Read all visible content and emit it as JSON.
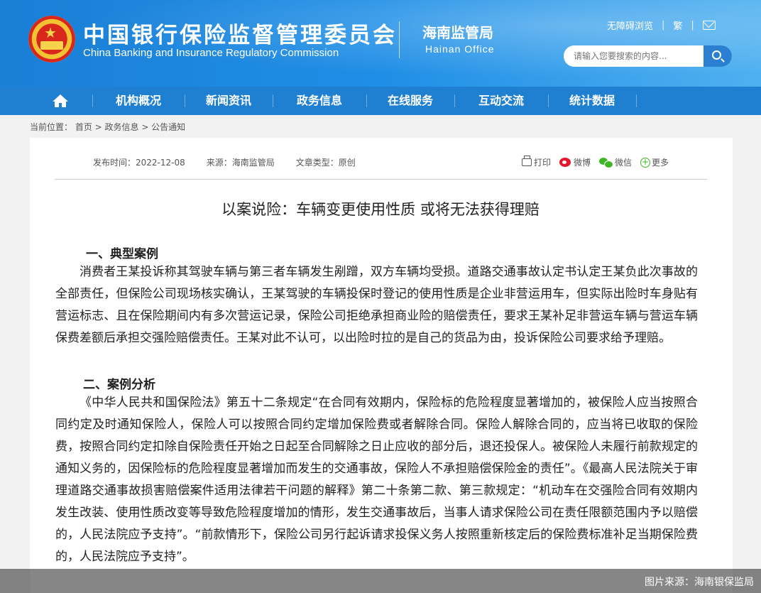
{
  "header": {
    "org_cn": "中国银行保险监督管理委员会",
    "org_en": "China Banking and Insurance Regulatory Commission",
    "office_cn": "海南监管局",
    "office_en": "Hainan Office",
    "links": [
      "无障碍浏览",
      "繁"
    ],
    "icons": [
      "emblem",
      "mail-icon",
      "search-icon"
    ]
  },
  "search": {
    "placeholder": "请输入您要搜索的内容..."
  },
  "nav": {
    "items": [
      "机构概况",
      "新闻资讯",
      "政务信息",
      "在线服务",
      "互动交流",
      "统计数据"
    ]
  },
  "breadcrumb": "当前位置：  首页 > 政务信息 > 公告通知",
  "article": {
    "meta": {
      "date": "发布时间：2022-12-08",
      "source": "来源：海南监管局",
      "type": "文章类型：原创"
    },
    "share": [
      "打印",
      "微博",
      "微信",
      "更多"
    ],
    "title": "以案说险：车辆变更使用性质 或将无法获得理赔",
    "section1": "一、典型案例",
    "para1": "消费者王某投诉称其驾驶车辆与第三者车辆发生剐蹭，双方车辆均受损。道路交通事故认定书认定王某负此次事故的全部责任，但保险公司现场核实确认，王某驾驶的车辆投保时登记的使用性质是企业非营运用车，但实际出险时车身贴有营运标志、且在保险期间内有多次营运记录，保险公司拒绝承担商业险的赔偿责任，要求王某补足非营运车辆与营运车辆保费差额后承担交强险赔偿责任。王某对此不认可，以出险时拉的是自己的货品为由，投诉保险公司要求给予理赔。",
    "section2": "二、案例分析",
    "para2": "《中华人民共和国保险法》第五十二条规定“在合同有效期内，保险标的危险程度显著增加的，被保险人应当按照合同约定及时通知保险人，保险人可以按照合同约定增加保险费或者解除合同。保险人解除合同的，应当将已收取的保险费，按照合同约定扣除自保险责任开始之日起至合同解除之日止应收的部分后，退还投保人。被保险人未履行前款规定的通知义务的，因保险标的危险程度显著增加而发生的交通事故，保险人不承担赔偿保险金的责任”。《最高人民法院关于审理道路交通事故损害赔偿案件适用法律若干问题的解释》第二十条第二款、第三款规定：“机动车在交强险合同有效期内发生改装、使用性质改变等导致危险程度增加的情形，发生交通事故后，当事人请求保险公司在责任限额范围内予以赔偿的，人民法院应予支持”。“前款情形下，保险公司另行起诉请求投保义务人按照重新核定后的保险费标准补足当期保险费的，人民法院应予支持”。"
  },
  "caption": "图片来源：海南银保监局",
  "colors": {
    "header": "#1f8ee6",
    "nav": "#1f7fd1",
    "search_button": "#2a7fd0"
  }
}
